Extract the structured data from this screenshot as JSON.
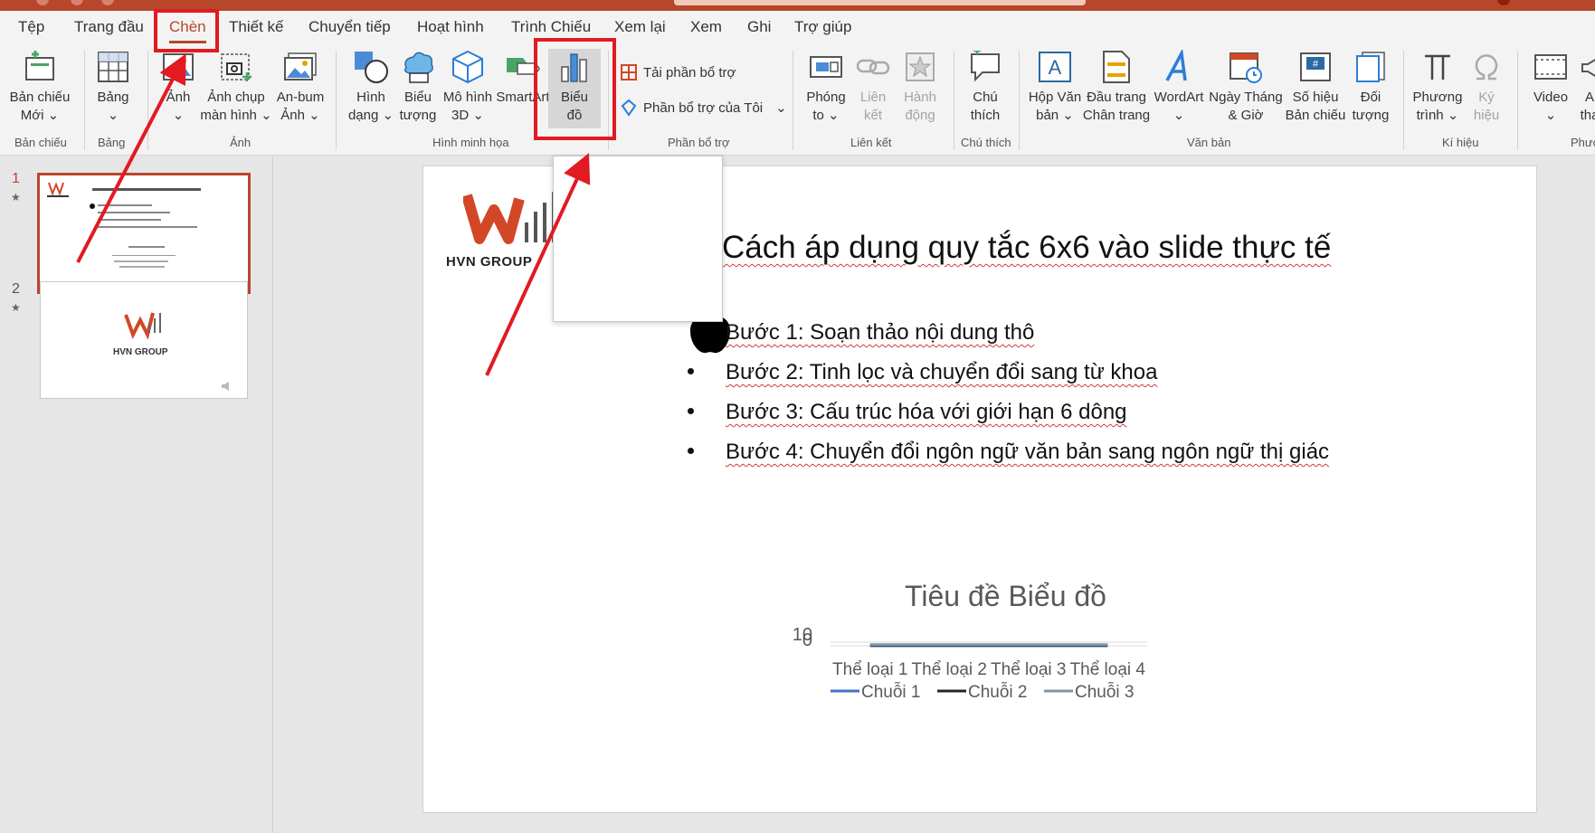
{
  "tabs": [
    "Tệp",
    "Trang đầu",
    "Chèn",
    "Thiết kế",
    "Chuyển tiếp",
    "Hoạt hình",
    "Trình Chiếu",
    "Xem lại",
    "Xem",
    "Ghi",
    "Trợ giúp"
  ],
  "ribbon": {
    "new_slide": [
      "Bản chiếu",
      "Mới ⌄"
    ],
    "table": [
      "Bảng",
      "⌄"
    ],
    "picture": [
      "Ảnh",
      "⌄"
    ],
    "screenshot": [
      "Ảnh chụp",
      "màn hình ⌄"
    ],
    "album": [
      "An-bum",
      "Ảnh ⌄"
    ],
    "shapes": [
      "Hình",
      "dạng ⌄"
    ],
    "icons": [
      "Biểu",
      "tượng"
    ],
    "model3d": [
      "Mô hình",
      "3D ⌄"
    ],
    "smartart": [
      "SmartArt",
      ""
    ],
    "chart": [
      "Biểu",
      "đồ"
    ],
    "get_addins": "Tải phần bổ trợ",
    "my_addins": "Phần bổ trợ của Tôi",
    "zoom": [
      "Phóng",
      "to ⌄"
    ],
    "link": [
      "Liên",
      "kết"
    ],
    "action": [
      "Hành",
      "động"
    ],
    "comment": [
      "Chú",
      "thích"
    ],
    "textbox": [
      "Hộp Văn",
      "bản ⌄"
    ],
    "header": [
      "Đầu trang",
      "Chân trang"
    ],
    "wordart": [
      "WordArt",
      "⌄"
    ],
    "datetime": [
      "Ngày Tháng",
      "& Giờ"
    ],
    "slidenum": [
      "Số hiệu",
      "Bản chiếu"
    ],
    "object": [
      "Đối",
      "tượng"
    ],
    "equation": [
      "Phương",
      "trình ⌄"
    ],
    "symbol": [
      "Ký",
      "hiệu"
    ],
    "video": [
      "Video",
      "⌄"
    ],
    "audio": [
      "A",
      "tha"
    ],
    "groups": {
      "slides": "Bản chiếu",
      "tables": "Bảng",
      "images": "Ảnh",
      "illustrations": "Hình minh họa",
      "addins": "Phần bổ trợ",
      "links": "Liên kết",
      "comments": "Chú thích",
      "text": "Văn bản",
      "symbols": "Kí hiệu",
      "media": "Phưc"
    }
  },
  "thumbnails": {
    "slide1_num": "1",
    "slide2_num": "2",
    "star": "★",
    "logo_text": "HVN GROUP"
  },
  "slide": {
    "logo_text": "HVN GROUP",
    "title": "Cách áp dụng quy tắc 6x6 vào slide thực tế",
    "bullets": [
      "Bước 1: Soạn thảo nội dung thô",
      "Bước 2: Tinh lọc và chuyển đổi sang từ khoa",
      "Bước 3: Cấu trúc hóa với giới hạn 6 dông",
      "Bước 4: Chuyển đổi ngôn ngữ văn bản sang ngôn ngữ thị giác"
    ]
  },
  "colors": {
    "accent": "#b7472a",
    "highlight": "#e21a22",
    "series1": "#4472c4",
    "series2": "#262626",
    "series3": "#7f96a8"
  },
  "chart_data": {
    "type": "line",
    "title": "Tiêu đề Biểu đồ",
    "categories": [
      "Thể loại 1",
      "Thể loại 2",
      "Thể loại 3",
      "Thể loại 4"
    ],
    "series": [
      {
        "name": "Chuỗi 1",
        "values": [
          0,
          0,
          0,
          0
        ]
      },
      {
        "name": "Chuỗi 2",
        "values": [
          0,
          0,
          0,
          0
        ]
      },
      {
        "name": "Chuỗi 3",
        "values": [
          0,
          0,
          0,
          0
        ]
      }
    ],
    "yticks": [
      "10",
      "0"
    ],
    "legend": "bottom"
  }
}
